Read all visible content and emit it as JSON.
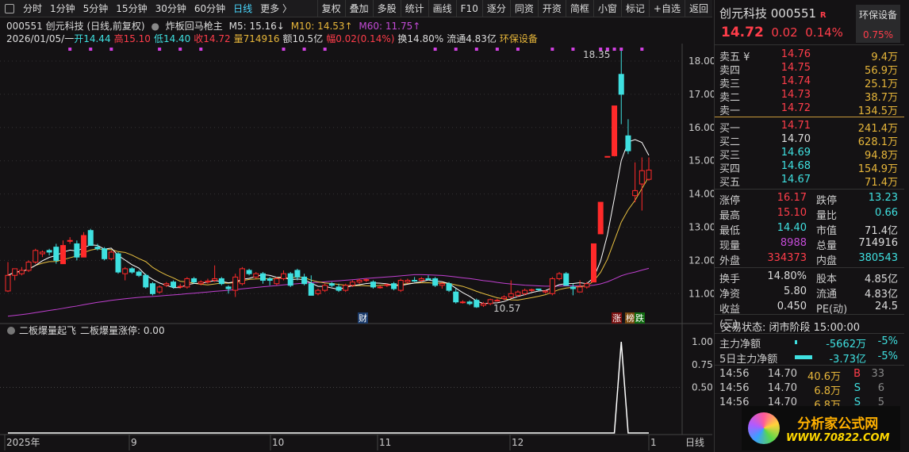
{
  "toolbar": {
    "periods": [
      "分时",
      "1分钟",
      "5分钟",
      "15分钟",
      "30分钟",
      "60分钟",
      "日线",
      "更多 〉"
    ],
    "active": "日线",
    "buttons": [
      "复权",
      "叠加",
      "多股",
      "统计",
      "画线",
      "F10",
      "逐分",
      "同资",
      "开资",
      "简框",
      "小窗",
      "标记",
      "+自选",
      "返回"
    ]
  },
  "info": {
    "title": "000551 创元科技 (日线,前复权)",
    "indicator": "炸板回马枪主",
    "m5": "M5: 15.16↓",
    "m10": "M10: 14.53↑",
    "m60": "M60: 11.75↑",
    "date": "2026/01/05/一",
    "open": "开14.44",
    "high": "高15.10",
    "low": "低14.40",
    "close": "收14.72",
    "vol": "量714916",
    "amount": "额10.5亿",
    "range": "幅0.02(0.14%)",
    "turnover": "换14.80%",
    "float": "流通4.83亿",
    "sector": "环保设备"
  },
  "price_axis": [
    "18.00",
    "17.00",
    "16.00",
    "15.00",
    "14.00",
    "13.00",
    "12.00",
    "11.00"
  ],
  "annotations": {
    "high": "18.35",
    "low": "10.57",
    "cai": "财",
    "zhang": "涨",
    "bang": "榜",
    "die": "跌"
  },
  "sub": {
    "title": "二板爆量起飞",
    "value": "二板爆量涨停: 0.00",
    "axis": [
      "1.00",
      "0.75",
      "0.50"
    ]
  },
  "xaxis": [
    "2025年",
    "9",
    "10",
    "11",
    "12",
    "1"
  ],
  "period_label": "日线",
  "colors": {
    "up": "#ff2a2a",
    "down": "#3fe0e0",
    "ma5": "#ffffff",
    "ma10": "#e8c040",
    "ma60": "#c040d0"
  },
  "chart_data": {
    "type": "candlestick",
    "ylim": [
      10.3,
      18.6
    ],
    "ohlc": [
      [
        11.08,
        11.95,
        11.05,
        11.55
      ],
      [
        11.55,
        11.75,
        11.4,
        11.75
      ],
      [
        11.6,
        11.8,
        11.55,
        11.7
      ],
      [
        11.7,
        12.0,
        11.65,
        11.95
      ],
      [
        11.95,
        12.35,
        11.9,
        12.3
      ],
      [
        12.2,
        12.3,
        12.1,
        12.25
      ],
      [
        12.3,
        12.35,
        12.15,
        12.25
      ],
      [
        12.4,
        12.5,
        11.9,
        12.0
      ],
      [
        11.9,
        12.6,
        11.9,
        12.45
      ],
      [
        12.6,
        12.7,
        12.5,
        12.6
      ],
      [
        12.5,
        12.6,
        12.0,
        12.1
      ],
      [
        12.1,
        12.85,
        12.1,
        12.75
      ],
      [
        12.9,
        12.95,
        12.45,
        12.45
      ],
      [
        12.4,
        12.5,
        12.3,
        12.35
      ],
      [
        12.35,
        12.4,
        12.0,
        12.05
      ],
      [
        12.05,
        12.3,
        12.0,
        12.25
      ],
      [
        12.2,
        12.25,
        11.6,
        11.65
      ],
      [
        11.6,
        11.8,
        11.4,
        11.75
      ],
      [
        11.75,
        11.8,
        11.6,
        11.65
      ],
      [
        11.65,
        11.7,
        11.5,
        11.55
      ],
      [
        11.55,
        11.6,
        11.15,
        11.2
      ],
      [
        11.3,
        11.35,
        10.95,
        11.0
      ],
      [
        11.05,
        11.25,
        11.0,
        11.2
      ],
      [
        11.25,
        11.35,
        11.2,
        11.3
      ],
      [
        11.35,
        11.4,
        11.15,
        11.2
      ],
      [
        11.2,
        11.3,
        11.15,
        11.22
      ],
      [
        11.2,
        11.5,
        11.15,
        11.45
      ],
      [
        11.45,
        11.5,
        11.3,
        11.35
      ],
      [
        11.3,
        11.4,
        11.25,
        11.35
      ],
      [
        11.35,
        11.45,
        11.3,
        11.38
      ],
      [
        11.4,
        11.85,
        11.35,
        11.45
      ],
      [
        11.45,
        11.5,
        11.25,
        11.3
      ],
      [
        11.2,
        11.25,
        11.0,
        11.15
      ],
      [
        11.1,
        11.6,
        10.9,
        11.5
      ],
      [
        11.3,
        11.8,
        11.25,
        11.75
      ],
      [
        11.7,
        11.75,
        11.55,
        11.6
      ],
      [
        11.5,
        11.65,
        11.45,
        11.6
      ],
      [
        11.6,
        11.65,
        11.3,
        11.4
      ],
      [
        11.45,
        11.5,
        11.25,
        11.4
      ],
      [
        11.3,
        11.5,
        11.25,
        11.45
      ],
      [
        11.45,
        11.7,
        11.4,
        11.6
      ],
      [
        11.6,
        11.65,
        11.2,
        11.25
      ],
      [
        11.7,
        11.75,
        11.4,
        11.5
      ],
      [
        11.5,
        11.6,
        11.25,
        11.3
      ],
      [
        11.3,
        11.55,
        10.95,
        10.95
      ],
      [
        11.0,
        11.15,
        10.95,
        11.1
      ],
      [
        11.1,
        11.3,
        11.05,
        11.25
      ],
      [
        11.3,
        11.35,
        11.2,
        11.25
      ],
      [
        11.2,
        11.3,
        11.05,
        11.1
      ],
      [
        11.1,
        11.3,
        11.05,
        11.25
      ],
      [
        11.25,
        11.4,
        11.2,
        11.35
      ],
      [
        11.35,
        11.45,
        11.3,
        11.4
      ],
      [
        11.4,
        11.45,
        11.35,
        11.42
      ],
      [
        11.35,
        11.4,
        11.15,
        11.2
      ],
      [
        11.2,
        11.25,
        11.15,
        11.2
      ],
      [
        11.25,
        11.3,
        11.2,
        11.27
      ],
      [
        11.3,
        11.35,
        11.1,
        11.15
      ],
      [
        11.1,
        11.45,
        11.05,
        11.4
      ],
      [
        11.35,
        11.45,
        11.3,
        11.4
      ],
      [
        11.4,
        11.5,
        11.35,
        11.38
      ],
      [
        11.4,
        11.5,
        11.35,
        11.45
      ],
      [
        11.45,
        11.55,
        11.4,
        11.42
      ],
      [
        11.45,
        11.5,
        11.2,
        11.25
      ],
      [
        11.25,
        11.35,
        11.15,
        11.3
      ],
      [
        11.3,
        11.35,
        11.05,
        11.1
      ],
      [
        11.05,
        11.15,
        10.7,
        10.75
      ],
      [
        10.75,
        10.8,
        10.7,
        10.75
      ],
      [
        10.75,
        10.8,
        10.65,
        10.7
      ],
      [
        10.8,
        10.85,
        10.57,
        10.6
      ],
      [
        10.65,
        10.75,
        10.6,
        10.7
      ],
      [
        10.7,
        10.85,
        10.65,
        10.82
      ],
      [
        10.8,
        10.85,
        10.78,
        10.8
      ],
      [
        10.85,
        10.95,
        10.8,
        10.9
      ],
      [
        10.9,
        11.4,
        10.85,
        11.0
      ],
      [
        10.95,
        11.1,
        10.9,
        11.05
      ],
      [
        11.0,
        11.15,
        10.95,
        11.1
      ],
      [
        11.1,
        11.15,
        11.05,
        11.12
      ],
      [
        11.14,
        11.15,
        11.08,
        11.12
      ],
      [
        11.05,
        11.1,
        11.0,
        11.08
      ],
      [
        11.0,
        11.5,
        10.95,
        11.45
      ],
      [
        11.45,
        11.65,
        11.4,
        11.6
      ],
      [
        11.6,
        11.65,
        11.25,
        11.25
      ],
      [
        11.2,
        11.3,
        10.95,
        11.15
      ],
      [
        11.05,
        11.4,
        11.05,
        11.2
      ],
      [
        11.2,
        11.35,
        11.15,
        11.3
      ],
      [
        11.35,
        12.5,
        11.35,
        12.5
      ],
      [
        12.8,
        13.75,
        12.8,
        13.75
      ],
      [
        15.13,
        15.13,
        15.13,
        15.13
      ],
      [
        15.15,
        16.65,
        15.13,
        16.65
      ],
      [
        17.6,
        18.35,
        16.1,
        17.0
      ],
      [
        15.75,
        16.25,
        15.2,
        15.3
      ],
      [
        13.95,
        14.95,
        13.75,
        14.1
      ],
      [
        14.3,
        15.1,
        13.5,
        14.7
      ],
      [
        14.44,
        15.1,
        14.4,
        14.72
      ]
    ],
    "signal_indices": [
      9,
      12,
      15,
      22,
      25,
      28,
      40,
      43,
      46,
      62,
      65,
      68,
      71,
      74,
      79,
      82,
      86,
      87,
      88,
      89,
      92
    ],
    "sub_values_spike_index": 89
  },
  "quote": {
    "name": "创元科技 000551",
    "flag": "R",
    "sector": "环保设备",
    "sector_pct": "0.75%",
    "price": "14.72",
    "chg": "0.02",
    "pct": "0.14%",
    "asks": [
      {
        "l": "卖五 ¥",
        "p": "14.76",
        "v": "9.4万"
      },
      {
        "l": "卖四",
        "p": "14.75",
        "v": "56.9万"
      },
      {
        "l": "卖三",
        "p": "14.74",
        "v": "25.1万"
      },
      {
        "l": "卖二",
        "p": "14.73",
        "v": "38.7万"
      },
      {
        "l": "卖一",
        "p": "14.72",
        "v": "134.5万"
      }
    ],
    "bids": [
      {
        "l": "买一",
        "p": "14.71",
        "v": "241.4万"
      },
      {
        "l": "买二",
        "p": "14.70",
        "v": "628.1万"
      },
      {
        "l": "买三",
        "p": "14.69",
        "v": "94.8万"
      },
      {
        "l": "买四",
        "p": "14.68",
        "v": "154.9万"
      },
      {
        "l": "买五",
        "p": "14.67",
        "v": "71.4万"
      }
    ],
    "stats": [
      [
        "涨停",
        "16.17",
        "跌停",
        "13.23"
      ],
      [
        "最高",
        "15.10",
        "量比",
        "0.66"
      ],
      [
        "最低",
        "14.40",
        "市值",
        "71.4亿"
      ],
      [
        "现量",
        "8988",
        "总量",
        "714916"
      ],
      [
        "外盘",
        "334373",
        "内盘",
        "380543"
      ]
    ],
    "stats2": [
      [
        "换手",
        "14.80%",
        "股本",
        "4.85亿"
      ],
      [
        "净资",
        "5.80",
        "流通",
        "4.83亿"
      ],
      [
        "收益(三)",
        "0.450",
        "PE(动)",
        "24.5"
      ]
    ],
    "status": "交易状态: 闭市阶段 15:00:00",
    "flows": [
      {
        "l": "主力净额",
        "v": "-5662万",
        "p": "-5%"
      },
      {
        "l": "5日主力净额",
        "v": "-3.73亿",
        "p": "-5%"
      }
    ],
    "ticks": [
      [
        "14:56",
        "14.70",
        "40.6万",
        "B",
        "33"
      ],
      [
        "14:56",
        "14.70",
        "6.8万",
        "S",
        "6"
      ],
      [
        "14:56",
        "14.70",
        "6.8万",
        "S",
        "5"
      ]
    ]
  },
  "logo": {
    "cn": "分析家公式网",
    "url": "WWW.70822.COM"
  }
}
